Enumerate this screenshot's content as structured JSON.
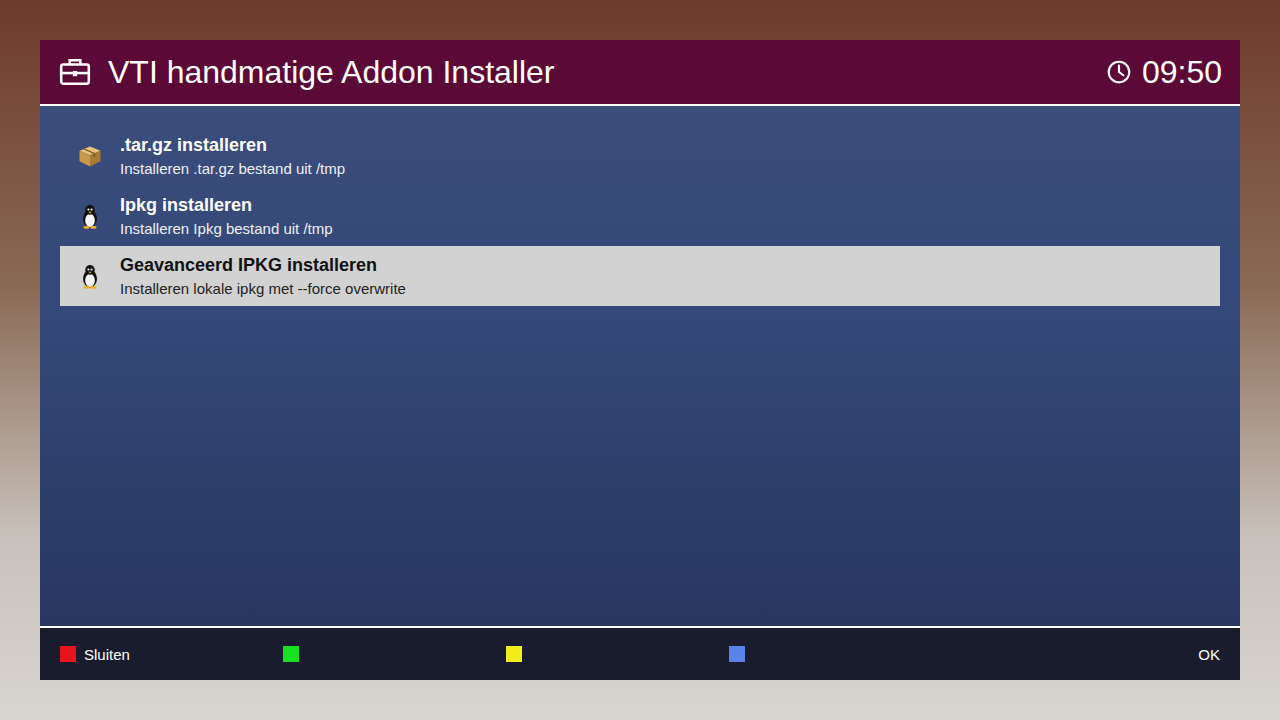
{
  "window": {
    "title": "VTI handmatige Addon Installer",
    "clock": "09:50"
  },
  "menu": {
    "items": [
      {
        "title": ".tar.gz installeren",
        "description": "Installeren .tar.gz bestand uit /tmp",
        "kind": "tarball",
        "selected": false
      },
      {
        "title": "Ipkg installeren",
        "description": "Installeren Ipkg bestand uit /tmp",
        "kind": "ipkg",
        "selected": false
      },
      {
        "title": "Geavanceerd IPKG installeren",
        "description": "Installeren lokale ipkg met --force overwrite",
        "kind": "ipkg",
        "selected": true
      }
    ]
  },
  "color_buttons": [
    {
      "label": "Sluiten",
      "color": "#e8141c"
    },
    {
      "label": "",
      "color": "#16e01f"
    },
    {
      "label": "",
      "color": "#f2ec1a"
    },
    {
      "label": "",
      "color": "#5b82e8"
    }
  ],
  "ok_label": "OK"
}
